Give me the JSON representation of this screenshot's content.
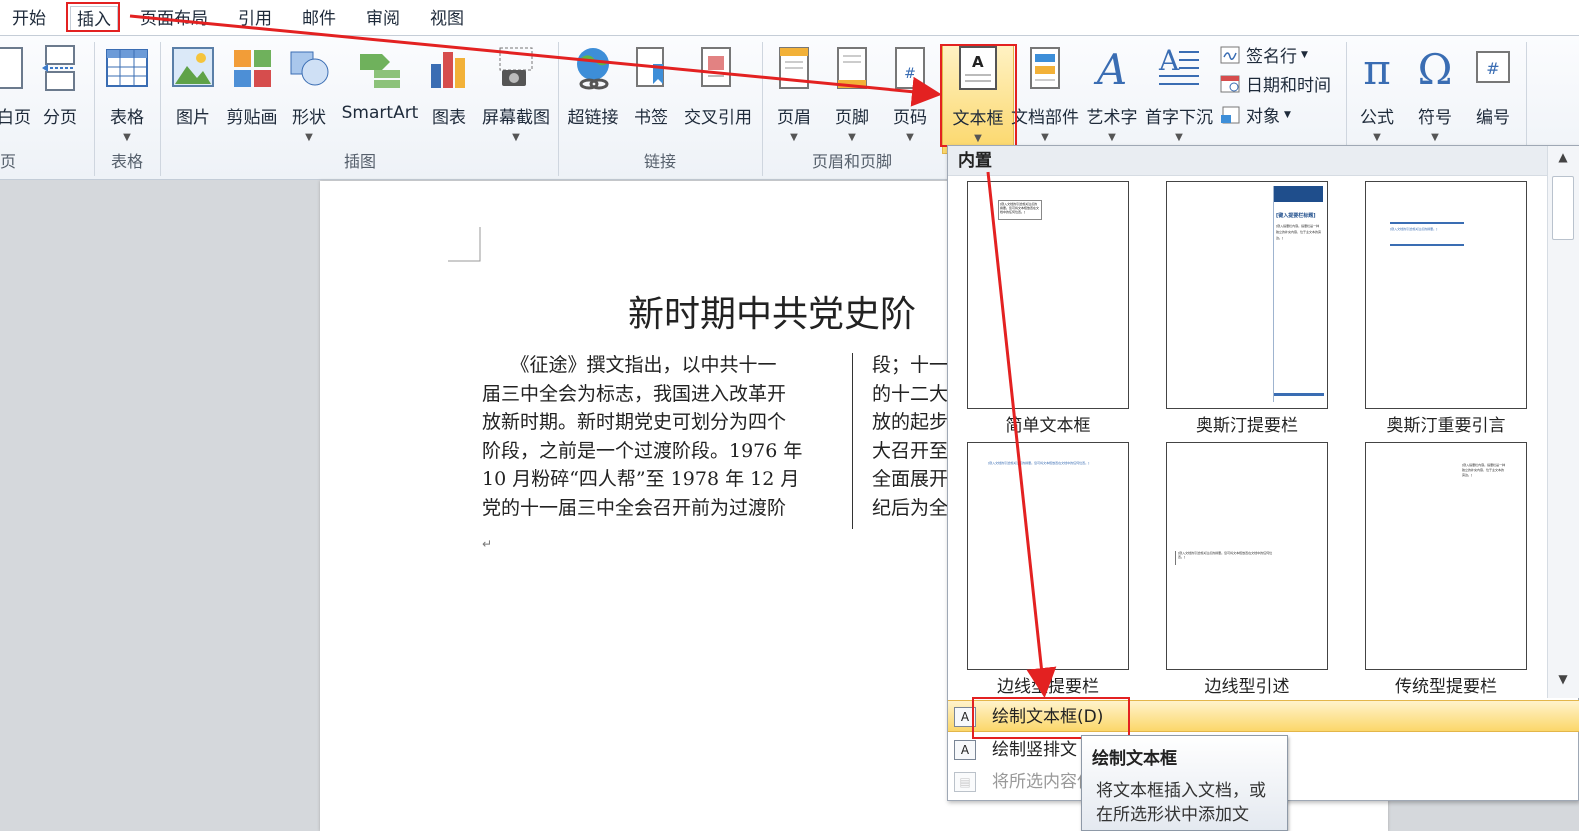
{
  "tabs": [
    "开始",
    "插入",
    "页面布局",
    "引用",
    "邮件",
    "审阅",
    "视图"
  ],
  "ribbon": {
    "page_partial": "白页",
    "page_break": "分页",
    "group_pages_partial": "页",
    "table": "表格",
    "group_table": "表格",
    "picture": "图片",
    "clipart": "剪贴画",
    "shapes": "形状",
    "smartart": "SmartArt",
    "chart": "图表",
    "screenshot": "屏幕截图",
    "group_illustrations": "插图",
    "hyperlink": "超链接",
    "bookmark": "书签",
    "crossref": "交叉引用",
    "group_links": "链接",
    "header": "页眉",
    "footer": "页脚",
    "page_number": "页码",
    "group_header_footer": "页眉和页脚",
    "textbox": "文本框",
    "quickparts": "文档部件",
    "wordart": "艺术字",
    "dropcap": "首字下沉",
    "signature": "签名行",
    "datetime": "日期和时间",
    "object": "对象",
    "equation": "公式",
    "symbol": "符号",
    "number": "编号"
  },
  "document": {
    "title": "新时期中共党史阶",
    "col1": [
      "　　《征途》撰文指出，以中共十一",
      "届三中全会为标志，我国进入改革开",
      "放新时期。新时期党史可划分为四个",
      "阶段，之前是一个过渡阶段。1976 年",
      "10 月粉碎“四人帮”至 1978 年 12 月",
      "党的十一届三中全会召开前为过渡阶"
    ],
    "col2": [
      "段；十一",
      "的十二大",
      "放的起步",
      "大召开至",
      "全面展开",
      "纪后为全"
    ],
    "para_mark": "↵"
  },
  "gallery": {
    "section": "内置",
    "items": [
      "简单文本框",
      "奥斯汀提要栏",
      "奥斯汀重要引言",
      "边线型提要栏",
      "边线型引述",
      "传统型提要栏"
    ],
    "thumb_text": {
      "simple": "[键入文档的引述或关注点的摘要。您可将文本框放置在文档中的任何位置。]",
      "austin_title": "[键入提要栏标题]",
      "austin_body": "[键入提要栏内容。提要栏是一种独立的补充内容，位于主文本的旁边。]",
      "quote": "[键入文档的引述或关注点的摘要。]",
      "border_quote": "[键入文档的引述或关注点的摘要。您可将文本框放置在文档中的任何位置。]"
    }
  },
  "menu": {
    "draw_textbox": "绘制文本框(D)",
    "draw_vertical": "绘制竖排文",
    "save_selection": "将所选内容保存到文本框库(S)"
  },
  "tooltip": {
    "title": "绘制文本框",
    "body_line1": "将文本框插入文档，或",
    "body_line2": "在所选形状中添加文"
  },
  "colors": {
    "highlight": "#fbd76a",
    "annotation": "#e32121"
  }
}
